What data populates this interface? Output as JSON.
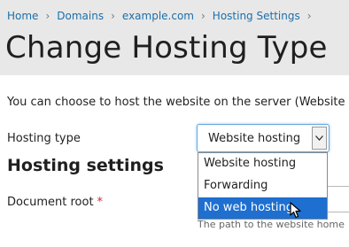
{
  "breadcrumb": {
    "items": [
      "Home",
      "Domains",
      "example.com",
      "Hosting Settings"
    ],
    "separator": "›"
  },
  "page_title": "Change Hosting Type",
  "intro_text": "You can choose to host the website on the server (Website h",
  "form": {
    "hosting_type_label": "Hosting type",
    "hosting_type_value": "Website hosting",
    "hosting_type_options": [
      "Website hosting",
      "Forwarding",
      "No web hosting"
    ],
    "highlighted_option": "No web hosting",
    "section_title": "Hosting settings",
    "document_root_label": "Document root",
    "required_marker": "*",
    "document_root_hint": "The path to the website home"
  },
  "icons": {
    "select_arrow": "chevron-down-icon",
    "pointer": "mouse-cursor-icon"
  },
  "colors": {
    "header_bg": "#e8e8e8",
    "link": "#1a6fad",
    "highlight": "#1e6fd0",
    "required": "#d62b2b",
    "focus_border": "#66a8dd"
  }
}
